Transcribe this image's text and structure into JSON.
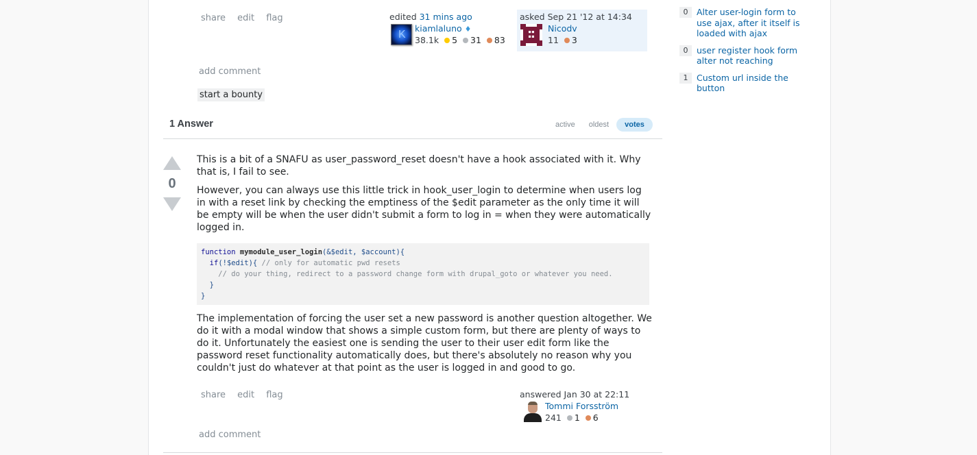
{
  "question": {
    "post_menu": [
      "share",
      "edit",
      "flag"
    ],
    "editor": {
      "action": "edited",
      "time": "31 mins ago",
      "name": "kiamlaluno",
      "moderator_diamond": "♦",
      "reputation": "38.1k",
      "gold": "5",
      "silver": "31",
      "bronze": "83",
      "avatar_icon": "avatar-kiamlaluno"
    },
    "owner": {
      "action": "asked",
      "time": "Sep 21 '12 at 14:34",
      "name": "Nicodv",
      "reputation": "11",
      "bronze": "3",
      "avatar_icon": "identicon-nicodv"
    },
    "add_comment": "add comment",
    "bounty": "start a bounty"
  },
  "related": [
    {
      "count": "0",
      "title": "Alter user-login form to use ajax, after it itself is loaded with ajax"
    },
    {
      "count": "0",
      "title": "user register hook form alter not reaching"
    },
    {
      "count": "1",
      "title": "Custom url inside the button"
    }
  ],
  "answers_header": {
    "title": "1 Answer",
    "tabs": [
      {
        "label": "active",
        "selected": false
      },
      {
        "label": "oldest",
        "selected": false
      },
      {
        "label": "votes",
        "selected": true
      }
    ]
  },
  "answer": {
    "votes": "0",
    "paragraphs": [
      "This is a bit of a SNAFU as user_password_reset doesn't have a hook associated with it. Why that is, I fail to see.",
      "However, you can always use this little trick in hook_user_login to determine when users log in with a reset link by checking the emptiness of the $edit parameter as the only time it will be empty will be when the user didn't submit a form to log in = when they were automatically logged in."
    ],
    "code": {
      "line1_kw": "function",
      "line1_fn": "mymodule_user_login",
      "line1_args": "(&$edit, $account){",
      "line2_kw": "if",
      "line2_cond": "(!$edit){",
      "line2_comment": "// only for automatic pwd resets",
      "line3_comment": "// do your thing, redirect to a password change form with drupal_goto or whatever you need.",
      "line4": "}",
      "line5": "}"
    },
    "paragraph_after": "The implementation of forcing the user set a new password is another question altogether. We do it with a modal window that shows a simple custom form, but there are plenty of ways to do it. Unfortunately the easiest one is sending the user to their user edit form like the password reset functionality automatically does, but there's absolutely no reason why you couldn't just do whatever at that point as the user is logged in and good to go.",
    "post_menu": [
      "share",
      "edit",
      "flag"
    ],
    "author": {
      "action": "answered",
      "time": "Jan 30 at 22:11",
      "name": "Tommi Forsström",
      "reputation": "241",
      "silver": "1",
      "bronze": "6",
      "avatar_icon": "avatar-tommi"
    },
    "add_comment": "add comment"
  }
}
